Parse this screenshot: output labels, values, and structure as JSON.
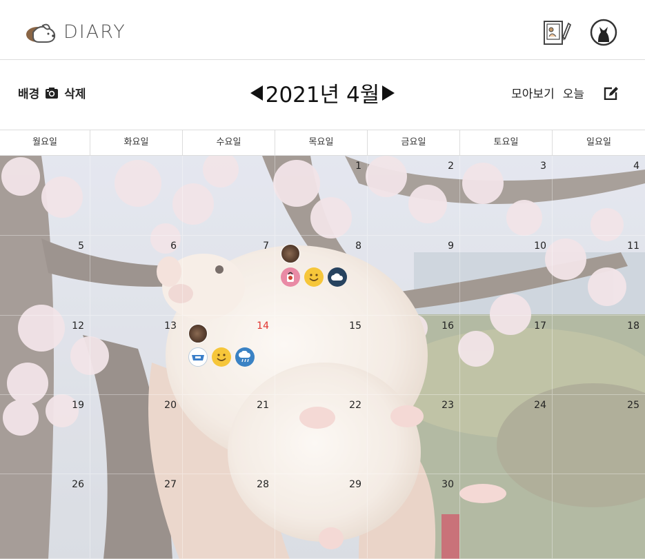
{
  "header": {
    "logo_text": "DIARY",
    "diary_icon": "diary-book-icon",
    "profile_icon": "cat-profile-icon"
  },
  "controls": {
    "background_label": "배경",
    "delete_label": "삭제",
    "month_title": "2021년 4월",
    "gallery_label": "모아보기",
    "today_label": "오늘"
  },
  "weekdays": [
    "월요일",
    "화요일",
    "수요일",
    "목요일",
    "금요일",
    "토요일",
    "일요일"
  ],
  "weeks": [
    [
      "",
      "",
      "",
      "1",
      "2",
      "3",
      "4"
    ],
    [
      "5",
      "6",
      "7",
      "8",
      "9",
      "10",
      "11"
    ],
    [
      "12",
      "13",
      "14",
      "15",
      "16",
      "17",
      "18"
    ],
    [
      "19",
      "20",
      "21",
      "22",
      "23",
      "24",
      "25"
    ],
    [
      "26",
      "27",
      "28",
      "29",
      "30",
      "",
      ""
    ]
  ],
  "today": "14",
  "colors": {
    "today": "#e0332e",
    "accent": "#222222"
  },
  "entries": [
    {
      "date": "8",
      "icons": [
        "pet-photo-icon",
        "cup-noodle-icon",
        "smile-emoji-icon",
        "cloud-weather-icon"
      ]
    },
    {
      "date": "14",
      "icons": [
        "pet-photo-icon",
        "pet-bowl-icon",
        "smile-emoji-icon",
        "rain-weather-icon"
      ]
    }
  ]
}
